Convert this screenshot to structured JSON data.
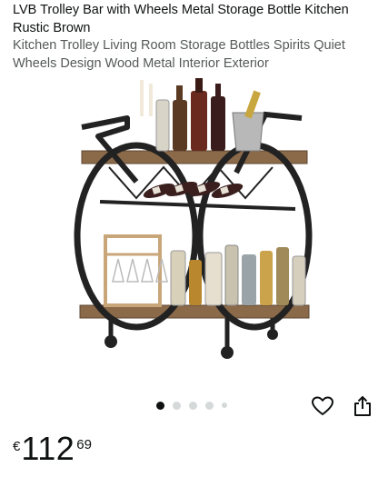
{
  "product": {
    "title": "LVB Trolley Bar with Wheels Metal Storage Bottle Kitchen Rustic Brown",
    "subtitle": "Kitchen Trolley Living Room Storage Bottles Spirits Quiet Wheels Design Wood Metal Interior Exterior"
  },
  "gallery": {
    "image_count": 5,
    "active_index": 0
  },
  "icons": {
    "wishlist": "heart-icon",
    "share": "share-icon"
  },
  "price": {
    "currency": "€",
    "whole": "112",
    "fraction": "69"
  },
  "colors": {
    "text": "#0f1111",
    "secondary_text": "#565959",
    "dot_inactive": "#d5d9d9",
    "dot_active": "#0f1111"
  }
}
